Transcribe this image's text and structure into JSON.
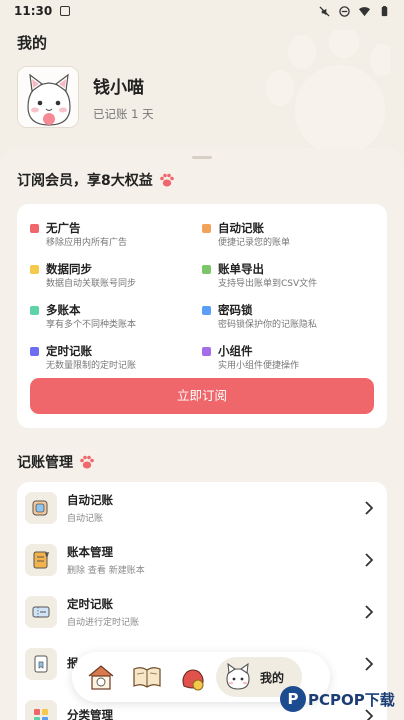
{
  "status_bar": {
    "time": "11:30"
  },
  "header": {
    "title": "我的"
  },
  "profile": {
    "name": "钱小喵",
    "record_days": "已记账 1 天"
  },
  "membership": {
    "title": "订阅会员，享8大权益",
    "benefits": [
      {
        "name": "无广告",
        "desc": "移除应用内所有广告",
        "color": "#f0676b"
      },
      {
        "name": "自动记账",
        "desc": "便捷记录您的账单",
        "color": "#f2a25a"
      },
      {
        "name": "数据同步",
        "desc": "数据自动关联账号同步",
        "color": "#f4c94c"
      },
      {
        "name": "账单导出",
        "desc": "支持导出账单到CSV文件",
        "color": "#7cc66a"
      },
      {
        "name": "多账本",
        "desc": "享有多个不同种类账本",
        "color": "#5fd3a8"
      },
      {
        "name": "密码锁",
        "desc": "密码锁保护你的记账隐私",
        "color": "#5a9ef5"
      },
      {
        "name": "定时记账",
        "desc": "无数量限制的定时记账",
        "color": "#6e6cf0"
      },
      {
        "name": "小组件",
        "desc": "实用小组件便捷操作",
        "color": "#a46ee8"
      }
    ],
    "subscribe_button": "立即订阅"
  },
  "management": {
    "title": "记账管理",
    "items": [
      {
        "title": "自动记账",
        "sub": "自动记账"
      },
      {
        "title": "账本管理",
        "sub": "删除 查看 新建账本"
      },
      {
        "title": "定时记账",
        "sub": "自动进行定时记账"
      },
      {
        "title": "报",
        "sub": ""
      },
      {
        "title": "分类管理",
        "sub": ""
      }
    ]
  },
  "bottom_nav": {
    "active_label": "我的"
  },
  "watermark": {
    "text": "PCPOP下载"
  },
  "colors": {
    "accent": "#f0676b",
    "paw": "#f0676b",
    "background": "#f3efe6"
  }
}
